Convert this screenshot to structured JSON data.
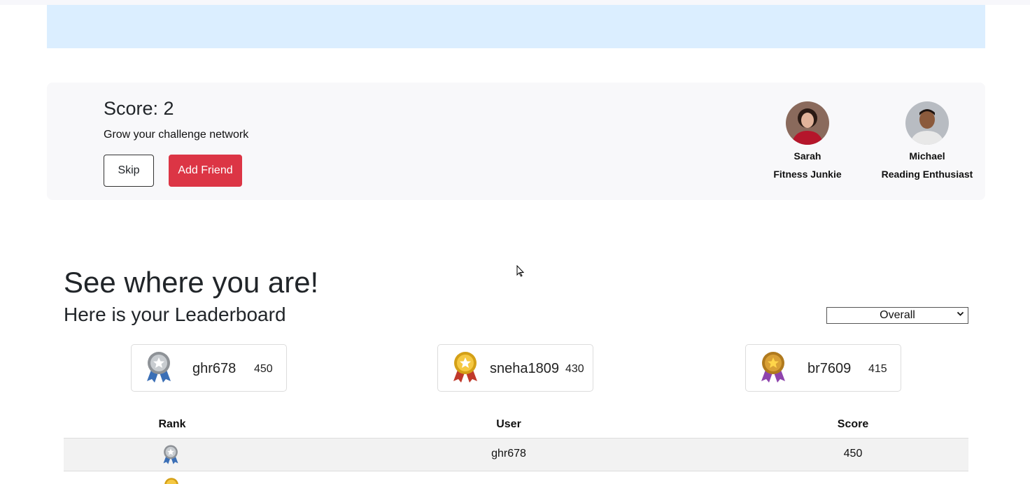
{
  "score_card": {
    "score_label": "Score: 2",
    "subtitle": "Grow your challenge network",
    "skip_label": "Skip",
    "add_friend_label": "Add Friend",
    "friends": [
      {
        "name": "Sarah",
        "tag": "Fitness Junkie"
      },
      {
        "name": "Michael",
        "tag": "Reading Enthusiast"
      }
    ]
  },
  "leaderboard": {
    "heading": "See where you are!",
    "subheading": "Here is your Leaderboard",
    "filter": {
      "selected": "Overall"
    },
    "podium": [
      {
        "user": "ghr678",
        "score": "450",
        "medal_icon": "silver-medal-icon"
      },
      {
        "user": "sneha1809",
        "score": "430",
        "medal_icon": "gold-medal-icon"
      },
      {
        "user": "br7609",
        "score": "415",
        "medal_icon": "bronze-medal-icon"
      }
    ],
    "columns": [
      "Rank",
      "User",
      "Score"
    ],
    "rows": [
      {
        "user": "ghr678",
        "score": "450",
        "medal_icon": "silver-medal-icon"
      }
    ]
  },
  "colors": {
    "banner": "#dbeeff",
    "card_bg": "#f8f8fa",
    "add_friend": "#dc3545",
    "row_bg": "#f2f2f2"
  }
}
